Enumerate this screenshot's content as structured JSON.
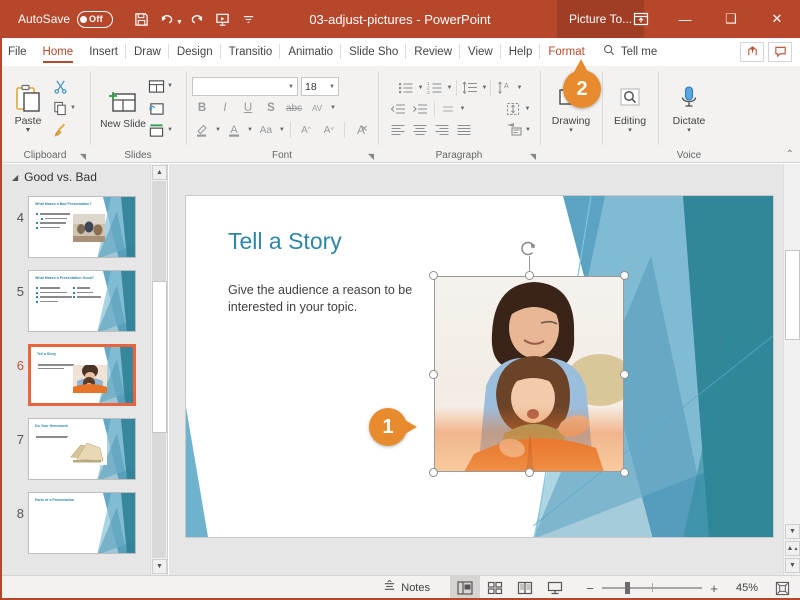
{
  "titlebar": {
    "autosave_label": "AutoSave",
    "autosave_state": "Off",
    "document_title": "03-adjust-pictures  -  PowerPoint",
    "contextual_tab": "Picture To...",
    "qat": [
      {
        "name": "save-icon",
        "tooltip": "Save"
      },
      {
        "name": "undo-icon",
        "tooltip": "Undo"
      },
      {
        "name": "redo-icon",
        "tooltip": "Redo"
      },
      {
        "name": "start-presentation-icon",
        "tooltip": "Start From Beginning"
      },
      {
        "name": "customize-qat-icon",
        "tooltip": "Customize Quick Access Toolbar"
      }
    ],
    "window_buttons": {
      "minimize": "—",
      "maximize": "❑",
      "close": "✕"
    },
    "accent_color": "#B7472A",
    "contextual_color": "#A03E25"
  },
  "tabs": [
    {
      "label": "File",
      "active": false
    },
    {
      "label": "Home",
      "active": true
    },
    {
      "label": "Insert",
      "active": false
    },
    {
      "label": "Draw",
      "active": false
    },
    {
      "label": "Design",
      "active": false
    },
    {
      "label": "Transitio",
      "active": false
    },
    {
      "label": "Animatio",
      "active": false
    },
    {
      "label": "Slide Sho",
      "active": false
    },
    {
      "label": "Review",
      "active": false
    },
    {
      "label": "View",
      "active": false
    },
    {
      "label": "Help",
      "active": false
    },
    {
      "label": "Format",
      "active": false,
      "contextual": true
    }
  ],
  "tellme": {
    "label": "Tell me",
    "icon": "search-icon"
  },
  "tab_right_buttons": [
    {
      "name": "share-button",
      "icon": "share-icon"
    },
    {
      "name": "comments-button",
      "icon": "comment-icon"
    }
  ],
  "ribbon": {
    "groups": [
      {
        "name": "clipboard",
        "title": "Clipboard",
        "paste_label": "Paste",
        "items": [
          "Cut",
          "Copy",
          "Format Painter"
        ]
      },
      {
        "name": "slides",
        "title": "Slides",
        "new_slide_label": "New Slide",
        "items": [
          "Layout",
          "Reset",
          "Section"
        ]
      },
      {
        "name": "font",
        "title": "Font",
        "font_name": "",
        "font_name_placeholder": "",
        "font_size": "18",
        "buttons": [
          "Bold",
          "Italic",
          "Underline",
          "Text Shadow",
          "Strikethrough",
          "Character Spacing",
          "Text Highlight Color",
          "Font Color",
          "Change Case",
          "Increase Font Size",
          "Decrease Font Size",
          "Clear All Formatting"
        ]
      },
      {
        "name": "paragraph",
        "title": "Paragraph",
        "buttons": [
          "Bullets",
          "Numbering",
          "Line Spacing",
          "Text Direction",
          "Decrease Indent",
          "Increase Indent",
          "Align Text",
          "Align Left",
          "Center",
          "Align Right",
          "Justify",
          "Convert to SmartArt"
        ]
      },
      {
        "name": "drawing",
        "title": "",
        "label": "Drawing",
        "dropdown": "▾"
      },
      {
        "name": "editing",
        "title": "",
        "label": "Editing",
        "dropdown": "▾"
      },
      {
        "name": "voice",
        "title": "Voice",
        "label": "Dictate",
        "dropdown": "▾"
      }
    ],
    "collapse_icon": "chevron-up-icon"
  },
  "thumbnails": {
    "section_title": "Good vs. Bad",
    "slides": [
      {
        "number": "4",
        "title": "What Makes a Bad Presentation?",
        "selected": false,
        "kind": "bullets-photo",
        "bullet_count": 4,
        "photo": "meeting"
      },
      {
        "number": "5",
        "title": "What Makes a Presentation Good?",
        "selected": false,
        "kind": "two-col-bullets",
        "bullet_count": 4,
        "photo": ""
      },
      {
        "number": "6",
        "title": "Tell a Story",
        "selected": true,
        "kind": "body-photo",
        "bullet_count": 0,
        "photo": "reading"
      },
      {
        "number": "7",
        "title": "Do Your Homework",
        "selected": false,
        "kind": "body-photo",
        "bullet_count": 0,
        "photo": "books"
      },
      {
        "number": "8",
        "title": "Parts of a Presentation",
        "selected": false,
        "kind": "title-only",
        "bullet_count": 0,
        "photo": ""
      }
    ]
  },
  "slide": {
    "title": "Tell a Story",
    "body": "Give the audience a reason to be interested in your topic.",
    "title_color": "#2E86AB",
    "picture_alt": "Mother and daughter reading a book together",
    "selection": {
      "handles": 8,
      "rotate_handle": true
    }
  },
  "callouts": [
    {
      "number": "1",
      "color": "#E78B2E",
      "target": "picture-left-handle"
    },
    {
      "number": "2",
      "color": "#E78B2E",
      "target": "drawing-group"
    }
  ],
  "statusbar": {
    "notes_label": "Notes",
    "views": [
      {
        "name": "normal-view",
        "label": "Normal",
        "active": true
      },
      {
        "name": "slide-sorter-view",
        "label": "Slide Sorter",
        "active": false
      },
      {
        "name": "reading-view",
        "label": "Reading View",
        "active": false
      },
      {
        "name": "slide-show-view",
        "label": "Slide Show",
        "active": false
      }
    ],
    "zoom_out": "−",
    "zoom_in": "+",
    "zoom_percent": "45%",
    "fit_label": "Fit slide to current window"
  }
}
